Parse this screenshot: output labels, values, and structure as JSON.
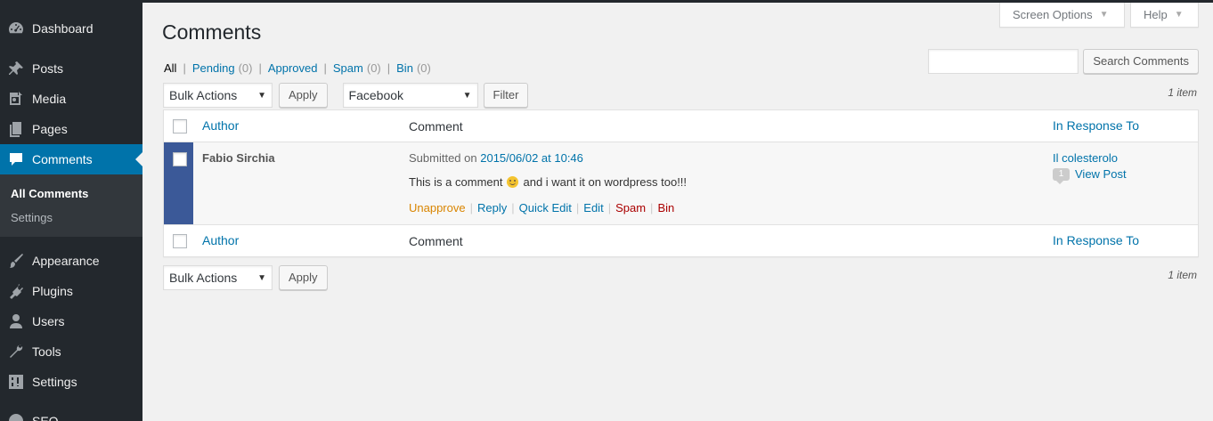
{
  "sidebar": {
    "items": [
      {
        "label": "Dashboard",
        "icon": "dashboard-icon"
      },
      {
        "label": "Posts",
        "icon": "pushpin-icon"
      },
      {
        "label": "Media",
        "icon": "media-icon"
      },
      {
        "label": "Pages",
        "icon": "pages-icon"
      },
      {
        "label": "Comments",
        "icon": "comment-icon"
      },
      {
        "label": "Appearance",
        "icon": "paintbrush-icon"
      },
      {
        "label": "Plugins",
        "icon": "plugin-icon"
      },
      {
        "label": "Users",
        "icon": "user-icon"
      },
      {
        "label": "Tools",
        "icon": "wrench-icon"
      },
      {
        "label": "Settings",
        "icon": "settings-icon"
      },
      {
        "label": "SEO",
        "icon": "seo-icon"
      }
    ],
    "submenu": [
      "All Comments",
      "Settings"
    ]
  },
  "screen_options": "Screen Options",
  "help": "Help",
  "page_title": "Comments",
  "filters": {
    "all": "All",
    "pending": "Pending",
    "pending_count": "(0)",
    "approved": "Approved",
    "spam": "Spam",
    "spam_count": "(0)",
    "bin": "Bin",
    "bin_count": "(0)"
  },
  "search": {
    "button": "Search Comments",
    "value": ""
  },
  "tablenav": {
    "bulk_actions": "Bulk Actions",
    "apply": "Apply",
    "type_filter": "Facebook",
    "filter": "Filter",
    "count": "1 item"
  },
  "table": {
    "headers": {
      "author": "Author",
      "comment": "Comment",
      "response": "In Response To"
    },
    "rows": [
      {
        "author": "Fabio Sirchia",
        "submitted_prefix": "Submitted on",
        "submitted_date": "2015/06/02 at 10:46",
        "text_before": "This is a comment",
        "text_after": "and i want it on wordpress too!!!",
        "actions": [
          "Unapprove",
          "Reply",
          "Quick Edit",
          "Edit",
          "Spam",
          "Bin"
        ],
        "response_title": "Il colesterolo",
        "comment_count": "1",
        "view_post": "View Post"
      }
    ]
  },
  "colors": {
    "sidebar": "#23282d",
    "current": "#0073aa",
    "unapproved_bar": "#3b5998",
    "link": "#0073aa"
  }
}
